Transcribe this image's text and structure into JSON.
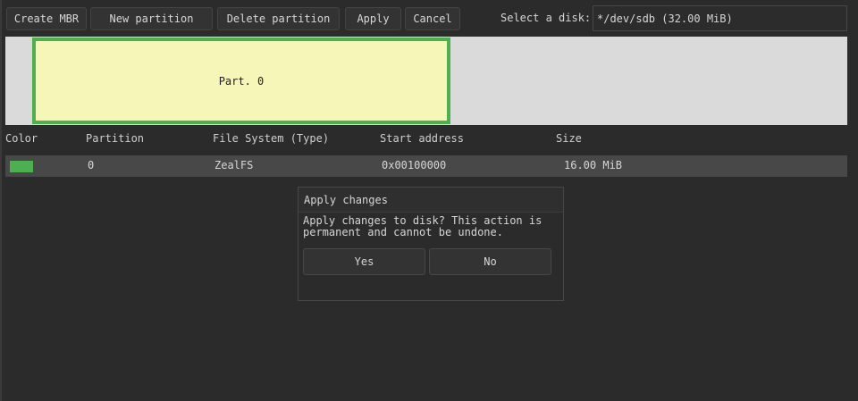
{
  "toolbar": {
    "create_mbr": "Create MBR",
    "new_partition": "New partition",
    "delete_partition": "Delete partition",
    "apply": "Apply",
    "cancel": "Cancel"
  },
  "disk_selector": {
    "label": "Select a disk:",
    "value": "*/dev/sdb (32.00 MiB)"
  },
  "disk_map": {
    "partitions": [
      {
        "label": "Part. 0",
        "color": "#f6f6b8",
        "border_color": "#4caf50"
      }
    ],
    "free_space_color": "#dadada"
  },
  "table": {
    "headers": [
      "Color",
      "Partition",
      "File System (Type)",
      "Start address",
      "Size"
    ],
    "rows": [
      {
        "color": "#4caf50",
        "partition": "0",
        "filesystem": "ZealFS",
        "start": "0x00100000",
        "size": "16.00 MiB"
      }
    ]
  },
  "dialog": {
    "title": "Apply changes",
    "message": "Apply changes to disk? This action is permanent and cannot be undone.",
    "yes": "Yes",
    "no": "No"
  },
  "colors": {
    "background": "#2b2b2b",
    "accent_green": "#4caf50",
    "selected_row": "#484848"
  }
}
